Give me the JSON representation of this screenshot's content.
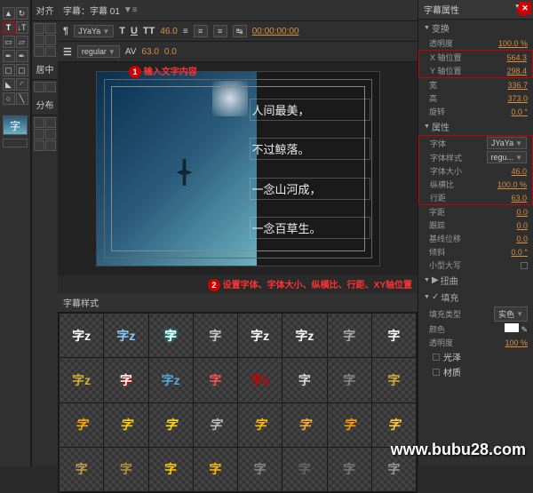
{
  "header": {
    "tab_label": "字幕：字幕 01",
    "menu": "▼≡"
  },
  "toolbar": {
    "font_family": "JYaYa",
    "font_style": "regular",
    "font_size": "46.0",
    "leading": "63.0",
    "timecode": "00:00:00:00"
  },
  "canvas": {
    "text_lines": [
      "人间最美，",
      "不过鲸落。",
      "一念山河成，",
      "一念百草生。"
    ]
  },
  "annotations": {
    "a1": "输入文字内容",
    "a2": "设置字体、字体大小、纵横比、行距、XY轴位置"
  },
  "styles": {
    "header": "字幕样式"
  },
  "left_panels": {
    "align": "对齐",
    "center": "居中",
    "distribute": "分布"
  },
  "properties": {
    "title": "字幕属性",
    "sections": {
      "transform": "变换",
      "props": "属性",
      "distort": "扭曲",
      "fill": "填充"
    },
    "opacity_label": "透明度",
    "opacity": "100.0",
    "x_label": "X 轴位置",
    "x": "564.3",
    "y_label": "Y 轴位置",
    "y": "298.4",
    "width_label": "宽",
    "width": "336.7",
    "height_label": "高",
    "height": "373.0",
    "rotate_label": "旋转",
    "rotate": "0.0",
    "font_label": "字体",
    "font": "JYaYa",
    "font_style_label": "字体样式",
    "font_style": "regu...",
    "font_size_label": "字体大小",
    "font_size": "46.0",
    "aspect_label": "纵横比",
    "aspect": "100.0",
    "leading_label": "行距",
    "leading": "63.0",
    "kerning_label": "字距",
    "kerning": "0.0",
    "tracking_label": "跟踪",
    "tracking": "0.0",
    "baseline_label": "基线位移",
    "baseline": "0.0",
    "slant_label": "倾斜",
    "slant": "0.0",
    "smallcaps_label": "小型大写",
    "fill_type_label": "填充类型",
    "fill_type": "实色",
    "color_label": "颜色",
    "fill_opacity_label": "透明度",
    "fill_opacity": "100",
    "sheen_label": "光泽",
    "texture_label": "材质"
  },
  "watermark": "www.bubu28.com"
}
